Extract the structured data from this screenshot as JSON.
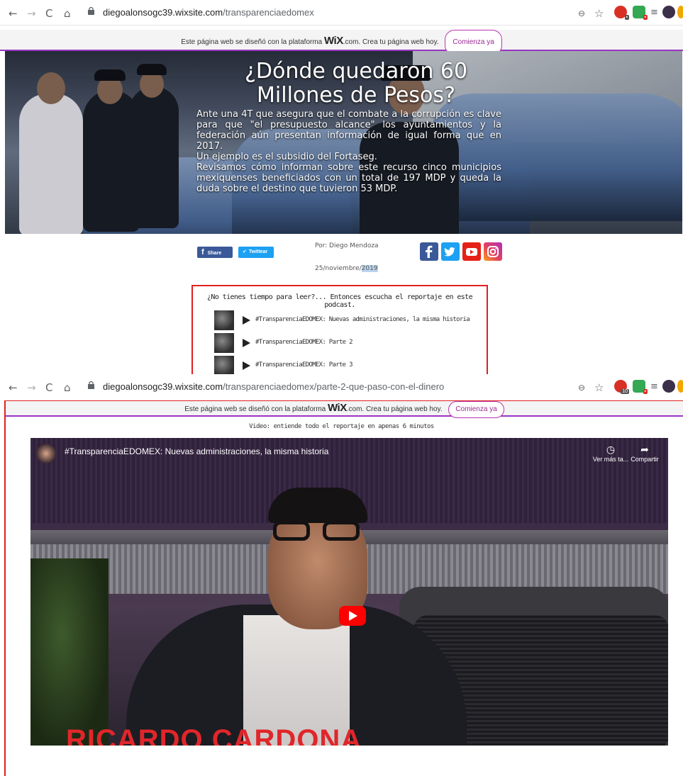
{
  "browser1": {
    "url_host": "diegoalonsogc39.wixsite.com",
    "url_path": "/transparenciaedomex"
  },
  "browser2": {
    "url_host": "diegoalonsogc39.wixsite.com",
    "url_path": "/transparenciaedomex/parte-2-que-paso-con-el-dinero",
    "badge_count": "10"
  },
  "wix_banner": {
    "text": "Este página web se diseñó con la plataforma",
    "logo": "WiX",
    "suffix": ".com. Crea tu página web hoy.",
    "cta": "Comienza ya"
  },
  "hero": {
    "title": "¿Dónde quedaron 60 Millones de Pesos?",
    "p1": "Ante una 4T que asegura que el combate a la corrupción es clave para que \"el presupuesto alcance\" los ayuntamientos y la federación aún presentan información de igual forma que en 2017.",
    "p2": "Un ejemplo es el subsidio del Fortaseg.",
    "p3": "Revisamos cómo informan sobre este recurso cinco municipios mexiquenses beneficiados con un total de 197 MDP y queda la duda sobre el destino que tuvieron 53 MDP."
  },
  "share": {
    "facebook": "Share",
    "twitter": "Twittear"
  },
  "byline": {
    "author": "Por: Diego Mendoza",
    "date_prefix": "25/noviembre/",
    "date_year": "2019"
  },
  "podcast": {
    "heading": "¿No tienes tiempo para leer?... Entonces escucha el reportaje en este podcast.",
    "tracks": [
      "#TransparenciaEDOMEX: Nuevas administraciones, la misma historia",
      "#TransparenciaEDOMEX: Parte 2",
      "#TransparenciaEDOMEX: Parte 3"
    ]
  },
  "video": {
    "label": "Video: entiende todo el reportaje en apenas 6 minutos",
    "title": "#TransparenciaEDOMEX: Nuevas administraciones, la misma historia",
    "watch_later": "Ver más ta...",
    "share": "Compartir",
    "overlay_name": "RICARDO CARDONA"
  },
  "colors": {
    "wix_accent": "#9a35c4",
    "highlight_red": "#e02020",
    "facebook": "#3b5998",
    "twitter": "#1da1f2",
    "youtube": "#ff0000"
  }
}
